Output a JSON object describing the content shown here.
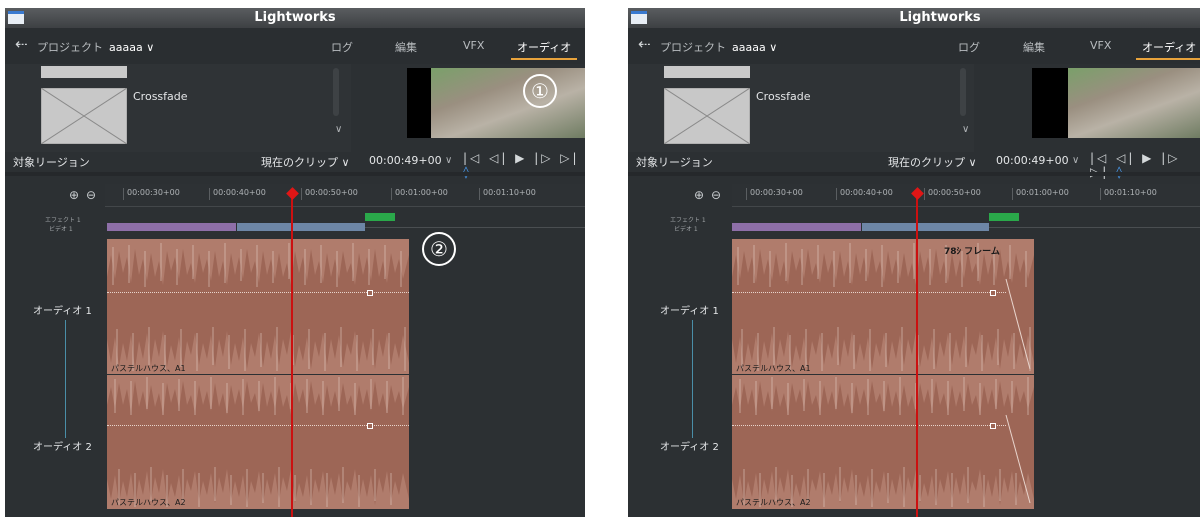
{
  "app": {
    "title": "Lightworks"
  },
  "menu": {
    "project_label": "プロジェクト",
    "project_name": "aaaaa ∨",
    "tabs": [
      "ログ",
      "編集",
      "VFX",
      "オーディオ"
    ],
    "active_tab": "オーディオ"
  },
  "effects": {
    "item": "Crossfade",
    "region_label": "対象リージョン",
    "region_value": "現在のクリップ ∨"
  },
  "viewer": {
    "timecode": "00:00:49+00",
    "timecode_chevron": "∨",
    "transport": "|◁ ◁| ▶ |▷ ▷|",
    "mark_icon": "◊"
  },
  "timeline": {
    "ruler": [
      "00:00:30+00",
      "00:00:40+00",
      "00:00:50+00",
      "00:01:00+00",
      "00:01:10+00"
    ],
    "effect_track": "エフェクト 1",
    "video_track": "ビデオ 1",
    "audio_tracks": [
      "オーディオ 1",
      "オーディオ 2"
    ],
    "clips": [
      "パステルハウス、A1",
      "パステルハウス、A2"
    ],
    "zoom_in": "⊕",
    "zoom_out": "⊖"
  },
  "annotations": {
    "badge1": "①",
    "badge2": "②",
    "frames_text": "78ｼ フレーム"
  },
  "colors": {
    "panel_bg": "#2c3033",
    "accent": "#e8a33c",
    "clip": "#9d6656",
    "purple_bar": "#8e6fa8",
    "blue_bar": "#6d86a6",
    "green_bar": "#2aa84a",
    "playhead": "#cc1010"
  }
}
